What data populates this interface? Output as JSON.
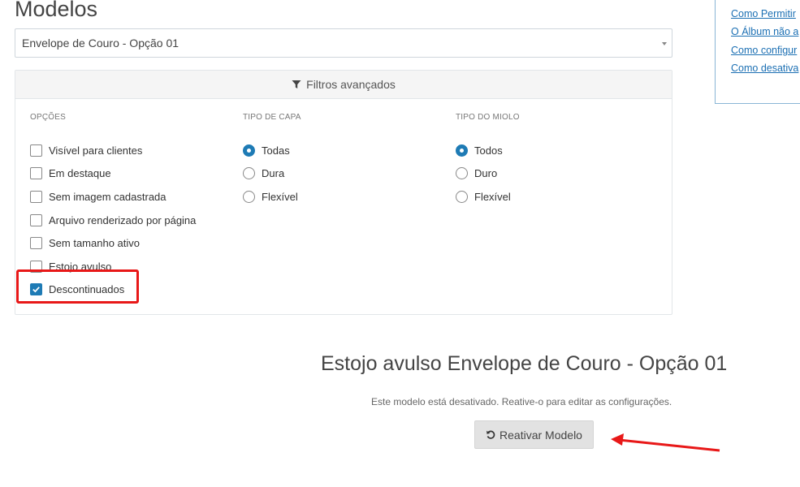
{
  "page_title": "Modelos",
  "model_select": {
    "selected": "Envelope de Couro - Opção 01"
  },
  "filters": {
    "header_label": "Filtros avançados",
    "columns": [
      {
        "label": "OPÇÕES",
        "type": "checkbox",
        "items": [
          {
            "label": "Visível para clientes",
            "checked": false
          },
          {
            "label": "Em destaque",
            "checked": false
          },
          {
            "label": "Sem imagem cadastrada",
            "checked": false
          },
          {
            "label": "Arquivo renderizado por página",
            "checked": false
          },
          {
            "label": "Sem tamanho ativo",
            "checked": false
          },
          {
            "label": "Estojo avulso",
            "checked": false
          },
          {
            "label": "Descontinuados",
            "checked": true
          }
        ]
      },
      {
        "label": "TIPO DE CAPA",
        "type": "radio",
        "items": [
          {
            "label": "Todas",
            "checked": true
          },
          {
            "label": "Dura",
            "checked": false
          },
          {
            "label": "Flexível",
            "checked": false
          }
        ]
      },
      {
        "label": "TIPO DO MIOLO",
        "type": "radio",
        "items": [
          {
            "label": "Todos",
            "checked": true
          },
          {
            "label": "Duro",
            "checked": false
          },
          {
            "label": "Flexível",
            "checked": false
          }
        ]
      }
    ]
  },
  "help_links": [
    "Como Permitir",
    "O Álbum não a",
    "Como configur",
    "Como desativa"
  ],
  "model": {
    "title": "Estojo avulso Envelope de Couro - Opção 01",
    "message": "Este modelo está desativado. Reative-o para editar as configurações.",
    "reactivate_label": "Reativar Modelo"
  },
  "colors": {
    "accent": "#1e7bb5",
    "annotation": "#e81818",
    "link": "#1b6fb3"
  }
}
